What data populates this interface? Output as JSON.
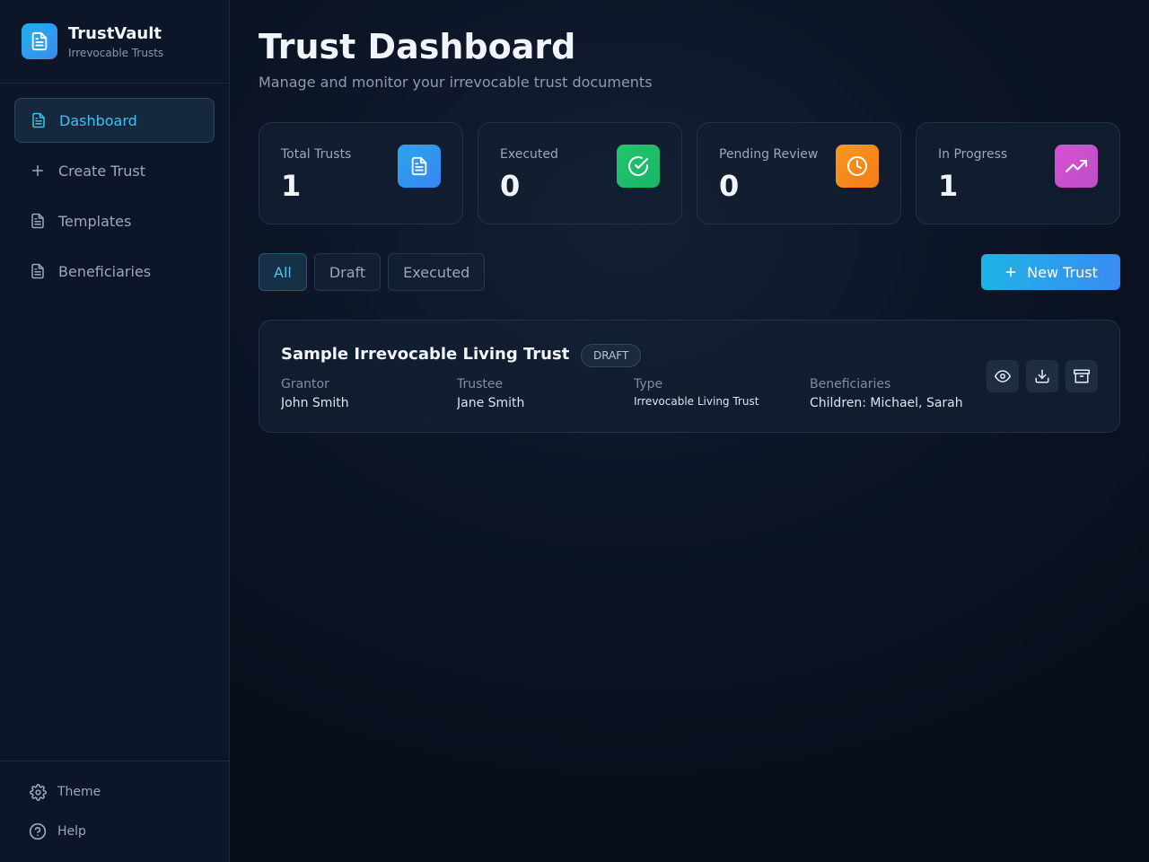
{
  "brand": {
    "name": "TrustVault",
    "subtitle": "Irrevocable Trusts"
  },
  "sidebar": {
    "items": [
      {
        "label": "Dashboard",
        "icon": "document-icon",
        "active": true
      },
      {
        "label": "Create Trust",
        "icon": "plus-icon",
        "active": false
      },
      {
        "label": "Templates",
        "icon": "document-icon",
        "active": false
      },
      {
        "label": "Beneficiaries",
        "icon": "document-icon",
        "active": false
      }
    ],
    "footer": [
      {
        "label": "Theme",
        "icon": "gear-icon"
      },
      {
        "label": "Help",
        "icon": "help-circle-icon"
      }
    ]
  },
  "header": {
    "title": "Trust Dashboard",
    "subtitle": "Manage and monitor your irrevocable trust documents"
  },
  "stats": [
    {
      "label": "Total Trusts",
      "value": "1",
      "icon": "document-icon",
      "color": "#2e9bf0"
    },
    {
      "label": "Executed",
      "value": "0",
      "icon": "check-circle-icon",
      "color": "#1fbf6a"
    },
    {
      "label": "Pending Review",
      "value": "0",
      "icon": "clock-icon",
      "color": "#f58a1a"
    },
    {
      "label": "In Progress",
      "value": "1",
      "icon": "trending-up-icon",
      "color": "#cf4fcf"
    }
  ],
  "filters": {
    "tabs": [
      "All",
      "Draft",
      "Executed"
    ],
    "selected": "All"
  },
  "new_trust_label": "New Trust",
  "trusts": [
    {
      "name": "Sample Irrevocable Living Trust",
      "status": "DRAFT",
      "fields": [
        {
          "label": "Grantor",
          "value": "John Smith"
        },
        {
          "label": "Trustee",
          "value": "Jane Smith"
        },
        {
          "label": "Type",
          "value": "Irrevocable Living Trust"
        },
        {
          "label": "Beneficiaries",
          "value": "Children: Michael, Sarah"
        }
      ],
      "actions": [
        "view-icon",
        "download-icon",
        "archive-icon"
      ]
    }
  ]
}
